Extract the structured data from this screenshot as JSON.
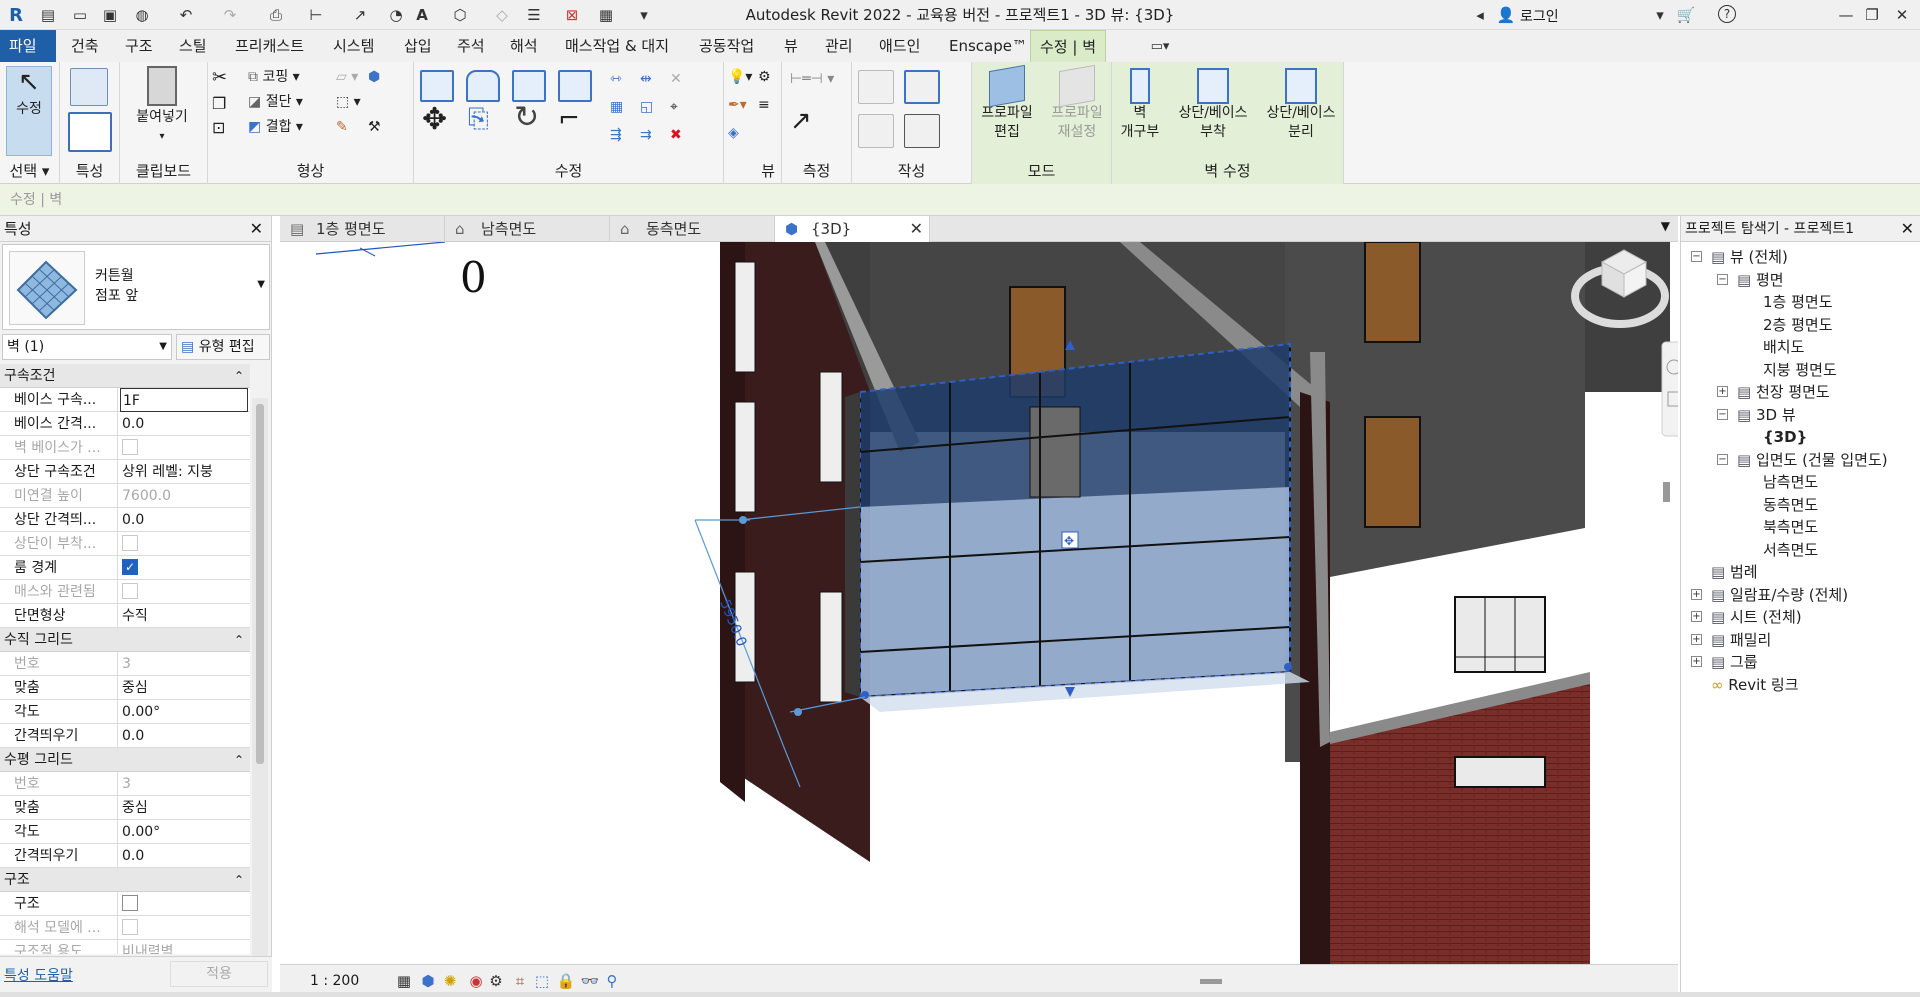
{
  "title": "Autodesk Revit 2022 - 교육용 버전 - 프로젝트1 - 3D 뷰: {3D}",
  "login": "로그인",
  "tabs": [
    "파일",
    "건축",
    "구조",
    "스틸",
    "프리캐스트",
    "시스템",
    "삽입",
    "주석",
    "해석",
    "매스작업 & 대지",
    "공동작업",
    "뷰",
    "관리",
    "애드인",
    "Enscape™",
    "수정 | 벽"
  ],
  "ribbon": {
    "select_label": "선택",
    "properties_label": "특성",
    "clipboard_label": "클립보드",
    "geometry_label": "형상",
    "modify_label": "수정",
    "view_label": "뷰",
    "measure_label": "측정",
    "create_label": "작성",
    "mode_label": "모드",
    "modwall_label": "벽 수정",
    "modify_btn": "수정",
    "paste_btn": "붙여넣기",
    "cope_btn": "코핑",
    "cut_btn": "절단",
    "join_btn": "결합",
    "edit_profile_1": "프로파일",
    "edit_profile_2": "편집",
    "reset_profile_1": "프로파일",
    "reset_profile_2": "재설정",
    "wall_opening_1": "벽",
    "wall_opening_2": "개구부",
    "attach_1": "상단/베이스",
    "attach_2": "부착",
    "detach_1": "상단/베이스",
    "detach_2": "분리"
  },
  "optionbar": "수정 | 벽",
  "properties": {
    "title": "특성",
    "type_name_1": "커튼월",
    "type_name_2": "점포 앞",
    "instance_filter": "벽 (1)",
    "edit_type": "유형 편집",
    "sections": [
      {
        "name": "구속조건",
        "rows": [
          {
            "k": "베이스 구속...",
            "v": "1F",
            "state": "edit"
          },
          {
            "k": "베이스 간격...",
            "v": "0.0",
            "state": ""
          },
          {
            "k": "벽 베이스가 ...",
            "v": "",
            "state": "dis",
            "chk": "dim"
          },
          {
            "k": "상단 구속조건",
            "v": "상위 레벨: 지붕",
            "state": ""
          },
          {
            "k": "미연결 높이",
            "v": "7600.0",
            "state": "dis"
          },
          {
            "k": "상단 간격띄...",
            "v": "0.0",
            "state": ""
          },
          {
            "k": "상단이 부착...",
            "v": "",
            "state": "dis",
            "chk": "dim"
          },
          {
            "k": "룸 경계",
            "v": "",
            "state": "",
            "chk": "on"
          },
          {
            "k": "매스와 관련됨",
            "v": "",
            "state": "dis",
            "chk": "dim"
          },
          {
            "k": "단면형상",
            "v": "수직",
            "state": ""
          }
        ]
      },
      {
        "name": "수직 그리드",
        "rows": [
          {
            "k": "번호",
            "v": "3",
            "state": "dis"
          },
          {
            "k": "맞춤",
            "v": "중심",
            "state": ""
          },
          {
            "k": "각도",
            "v": "0.00°",
            "state": ""
          },
          {
            "k": "간격띄우기",
            "v": "0.0",
            "state": ""
          }
        ]
      },
      {
        "name": "수평 그리드",
        "rows": [
          {
            "k": "번호",
            "v": "3",
            "state": "dis"
          },
          {
            "k": "맞춤",
            "v": "중심",
            "state": ""
          },
          {
            "k": "각도",
            "v": "0.00°",
            "state": ""
          },
          {
            "k": "간격띄우기",
            "v": "0.0",
            "state": ""
          }
        ]
      },
      {
        "name": "구조",
        "rows": [
          {
            "k": "구조",
            "v": "",
            "state": "",
            "chk": "off"
          },
          {
            "k": "해석 모델에 ...",
            "v": "",
            "state": "dis",
            "chk": "dim"
          },
          {
            "k": "구조적 용도",
            "v": "비내력벽",
            "state": "dis"
          }
        ]
      }
    ],
    "help": "특성 도움말",
    "apply": "적용"
  },
  "view_tabs": [
    "1층 평면도",
    "남측면도",
    "동측면도",
    "{3D}"
  ],
  "canvas": {
    "dimension": "5950.0",
    "level_text": "0"
  },
  "view_scale": "1 : 200",
  "browser": {
    "title": "프로젝트 탐색기 - 프로젝트1",
    "nodes": [
      {
        "t": "뷰 (전체)",
        "lvl": 0,
        "pm": "−"
      },
      {
        "t": "평면",
        "lvl": 1,
        "pm": "−"
      },
      {
        "t": "1층 평면도",
        "lvl": 2
      },
      {
        "t": "2층 평면도",
        "lvl": 2
      },
      {
        "t": "배치도",
        "lvl": 2
      },
      {
        "t": "지붕 평면도",
        "lvl": 2
      },
      {
        "t": "천장 평면도",
        "lvl": 1,
        "pm": "+"
      },
      {
        "t": "3D 뷰",
        "lvl": 1,
        "pm": "−"
      },
      {
        "t": "{3D}",
        "lvl": 2,
        "bold": true
      },
      {
        "t": "입면도 (건물 입면도)",
        "lvl": 1,
        "pm": "−"
      },
      {
        "t": "남측면도",
        "lvl": 2
      },
      {
        "t": "동측면도",
        "lvl": 2
      },
      {
        "t": "북측면도",
        "lvl": 2
      },
      {
        "t": "서측면도",
        "lvl": 2
      },
      {
        "t": "범례",
        "lvl": 0
      },
      {
        "t": "일람표/수량 (전체)",
        "lvl": 0,
        "pm": "+"
      },
      {
        "t": "시트 (전체)",
        "lvl": 0,
        "pm": "+"
      },
      {
        "t": "패밀리",
        "lvl": 0,
        "pm": "+"
      },
      {
        "t": "그룹",
        "lvl": 0,
        "pm": "+"
      },
      {
        "t": "Revit 링크",
        "lvl": 0
      }
    ]
  }
}
